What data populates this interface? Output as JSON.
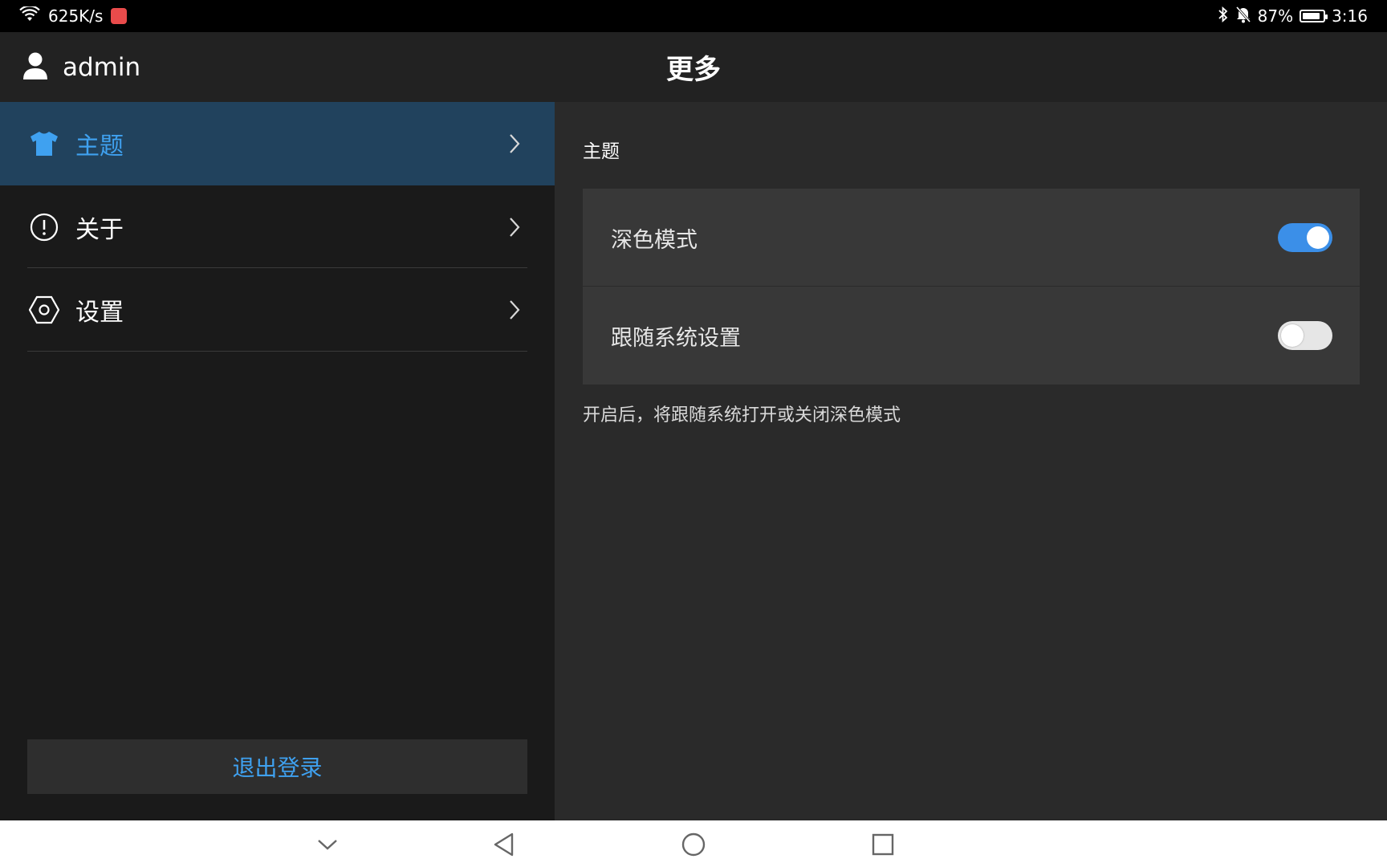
{
  "status_bar": {
    "network_speed": "625K/s",
    "battery_percent": "87%",
    "battery_level": 0.87,
    "time": "3:16",
    "icons": [
      "wifi-icon",
      "app-notification-icon",
      "bluetooth-icon",
      "mute-icon",
      "battery-icon"
    ]
  },
  "header": {
    "username": "admin",
    "title": "更多"
  },
  "sidebar": {
    "items": [
      {
        "label": "主题",
        "icon": "shirt-icon",
        "active": true
      },
      {
        "label": "关于",
        "icon": "info-icon",
        "active": false
      },
      {
        "label": "设置",
        "icon": "settings-icon",
        "active": false
      }
    ],
    "logout_label": "退出登录"
  },
  "main": {
    "section_title": "主题",
    "settings": [
      {
        "label": "深色模式",
        "enabled": true
      },
      {
        "label": "跟随系统设置",
        "enabled": false
      }
    ],
    "hint": "开启后，将跟随系统打开或关闭深色模式"
  },
  "colors": {
    "accent": "#3fa1f0",
    "toggle_on": "#3b8fe8",
    "active_row": "#21425d"
  },
  "nav_bar": {
    "icons": [
      "collapse-icon",
      "back-icon",
      "home-icon",
      "recents-icon"
    ]
  }
}
